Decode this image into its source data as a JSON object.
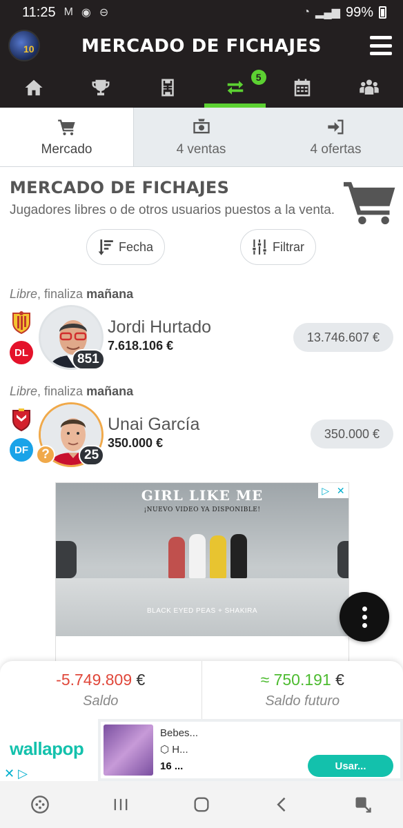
{
  "status_bar": {
    "time": "11:25",
    "battery": "99%"
  },
  "app": {
    "title": "MERCADO DE FICHAJES",
    "nav_badge": "5"
  },
  "subtabs": [
    {
      "label": "Mercado",
      "icon": "cart-icon"
    },
    {
      "label": "4 ventas",
      "icon": "money-icon"
    },
    {
      "label": "4 ofertas",
      "icon": "sign-in-icon"
    }
  ],
  "market": {
    "title": "MERCADO DE FICHAJES",
    "subtitle": "Jugadores libres o de otros usuarios puestos a la venta."
  },
  "filters": {
    "sort_label": "Fecha",
    "filter_label": "Filtrar"
  },
  "players": [
    {
      "status_type": "Libre",
      "status_mid": ", finaliza ",
      "status_when": "mañana",
      "position": "DL",
      "position_color": "#e4122a",
      "name": "Jordi Hurtado",
      "value": "7.618.106 €",
      "points": "851",
      "price": "13.746.607 €"
    },
    {
      "status_type": "Libre",
      "status_mid": ", finaliza ",
      "status_when": "mañana",
      "position": "DF",
      "position_color": "#1aa3e8",
      "name": "Unai García",
      "value": "350.000 €",
      "points": "25",
      "price": "350.000 €"
    }
  ],
  "ad": {
    "title": "GIRL LIKE ME",
    "subtitle": "¡NUEVO VIDEO YA DISPONIBLE!",
    "artist": "BLACK EYED PEAS + SHAKIRA"
  },
  "balance": {
    "saldo_value": "-5.749.809",
    "saldo_currency": "€",
    "saldo_label": "Saldo",
    "saldo_color": "#e0473a",
    "future_value": "≈ 750.191",
    "future_currency": "€",
    "future_label": "Saldo futuro",
    "future_color": "#4cbb2f"
  },
  "bottom_ad": {
    "brand": "wallapop",
    "product_title": "Bebes...",
    "product_sub": "H...",
    "product_price": "16 ...",
    "button": "Usar..."
  }
}
